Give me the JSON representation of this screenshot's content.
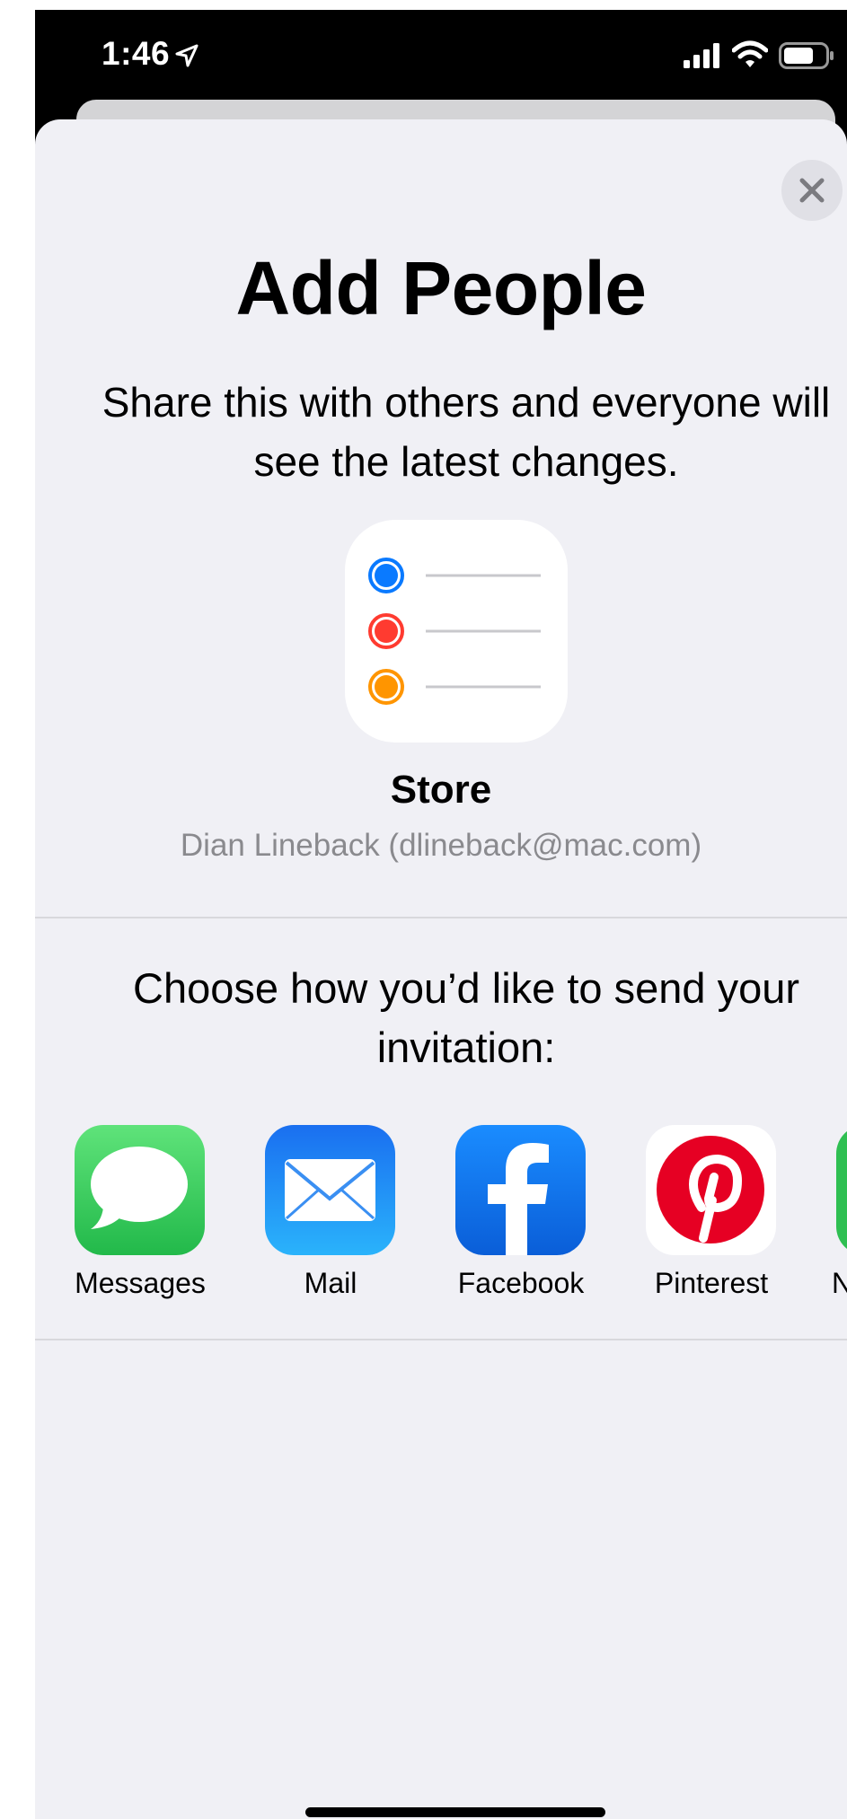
{
  "status_bar": {
    "time": "1:46",
    "location_icon": "location-arrow-icon",
    "signal_icon": "cellular-signal-icon",
    "wifi_icon": "wifi-icon",
    "battery_icon": "battery-icon"
  },
  "sheet": {
    "close_icon": "close-icon",
    "title": "Add People",
    "subtitle": "Share this with others and everyone will see the latest changes.",
    "list": {
      "icon": "reminders-list-icon",
      "name": "Store",
      "owner": "Dian Lineback (dlineback@mac.com)",
      "dot_colors": [
        "#0a7aff",
        "#ff3b30",
        "#ff9500"
      ]
    },
    "choose_text": "Choose how you’d like to send your invitation:",
    "share_options": [
      {
        "label": "Messages",
        "icon": "messages-icon",
        "color": "#34c759"
      },
      {
        "label": "Mail",
        "icon": "mail-icon",
        "color": "#1e88f5"
      },
      {
        "label": "Facebook",
        "icon": "facebook-icon",
        "color": "#1877f2"
      },
      {
        "label": "Pinterest",
        "icon": "pinterest-icon",
        "color": "#e60023"
      },
      {
        "label": "N",
        "icon": "partial-app-icon",
        "color": "#34c759"
      }
    ]
  }
}
